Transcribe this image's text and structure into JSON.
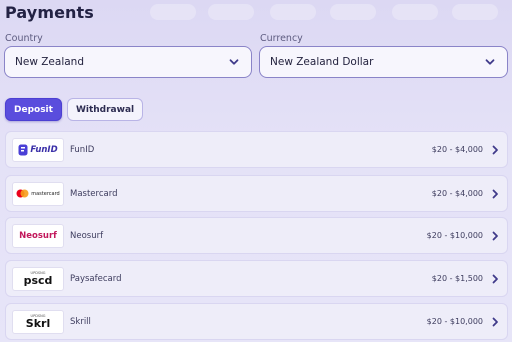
{
  "page": {
    "title": "Payments"
  },
  "filters": {
    "country": {
      "label": "Country",
      "value": "New Zealand"
    },
    "currency": {
      "label": "Currency",
      "value": "New Zealand Dollar"
    }
  },
  "tabs": [
    {
      "label": "Deposit",
      "active": true
    },
    {
      "label": "Withdrawal",
      "active": false
    }
  ],
  "methods": [
    {
      "name": "FunID",
      "range": "$20 - $4,000",
      "logo_text": "FunID",
      "logo_icon": "funid-logo"
    },
    {
      "name": "Mastercard",
      "range": "$20 - $4,000",
      "logo_text": "mastercard",
      "logo_icon": "mastercard-logo"
    },
    {
      "name": "Neosurf",
      "range": "$20 - $10,000",
      "logo_text": "Neosurf",
      "logo_icon": "neosurf-logo"
    },
    {
      "name": "Paysafecard",
      "range": "$20 - $1,500",
      "logo_text": "pscd",
      "logo_subtext": "UPDSNG",
      "logo_icon": "paysafecard-logo"
    },
    {
      "name": "Skrill",
      "range": "$20 - $10,000",
      "logo_text": "Skrl",
      "logo_subtext": "UPDSNG",
      "logo_icon": "skrill-logo"
    }
  ],
  "colors": {
    "accent": "#5a4ddd",
    "background": "#e2dff6",
    "neosurf": "#c2185b",
    "mastercard_red": "#eb001b",
    "mastercard_orange": "#f79e1b"
  }
}
